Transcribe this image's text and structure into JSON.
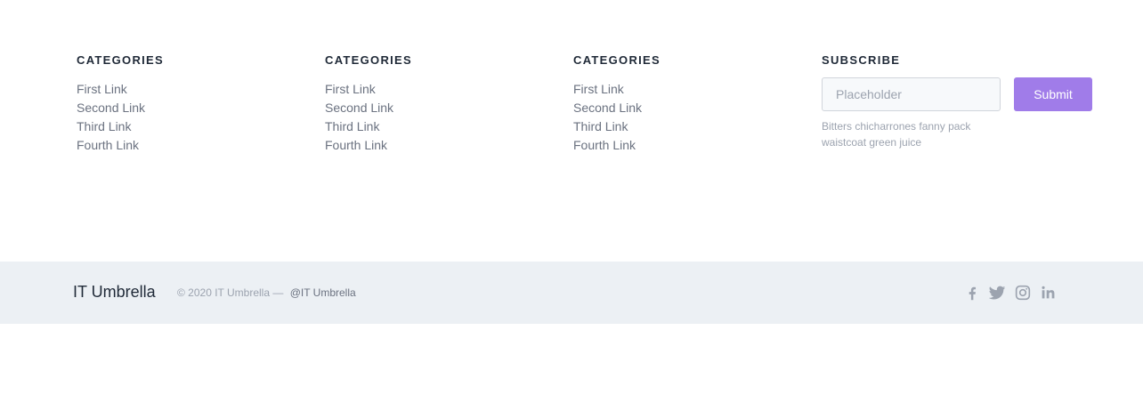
{
  "columns": [
    {
      "heading": "CATEGORIES",
      "links": [
        "First Link",
        "Second Link",
        "Third Link",
        "Fourth Link"
      ]
    },
    {
      "heading": "CATEGORIES",
      "links": [
        "First Link",
        "Second Link",
        "Third Link",
        "Fourth Link"
      ]
    },
    {
      "heading": "CATEGORIES",
      "links": [
        "First Link",
        "Second Link",
        "Third Link",
        "Fourth Link"
      ]
    }
  ],
  "subscribe": {
    "heading": "SUBSCRIBE",
    "placeholder": "Placeholder",
    "button_label": "Submit",
    "description": "Bitters chicharrones fanny pack waistcoat green juice"
  },
  "footer": {
    "brand": "IT Umbrella",
    "copyright": "© 2020 IT Umbrella —",
    "handle": "@IT Umbrella",
    "social_icons": [
      "facebook-icon",
      "twitter-icon",
      "instagram-icon",
      "linkedin-icon"
    ]
  },
  "colors": {
    "accent": "#a07ce9",
    "footer_bg": "#ecf0f4",
    "heading_text": "#1f2937",
    "link_text": "#6b7280",
    "muted_text": "#9ca3af"
  }
}
